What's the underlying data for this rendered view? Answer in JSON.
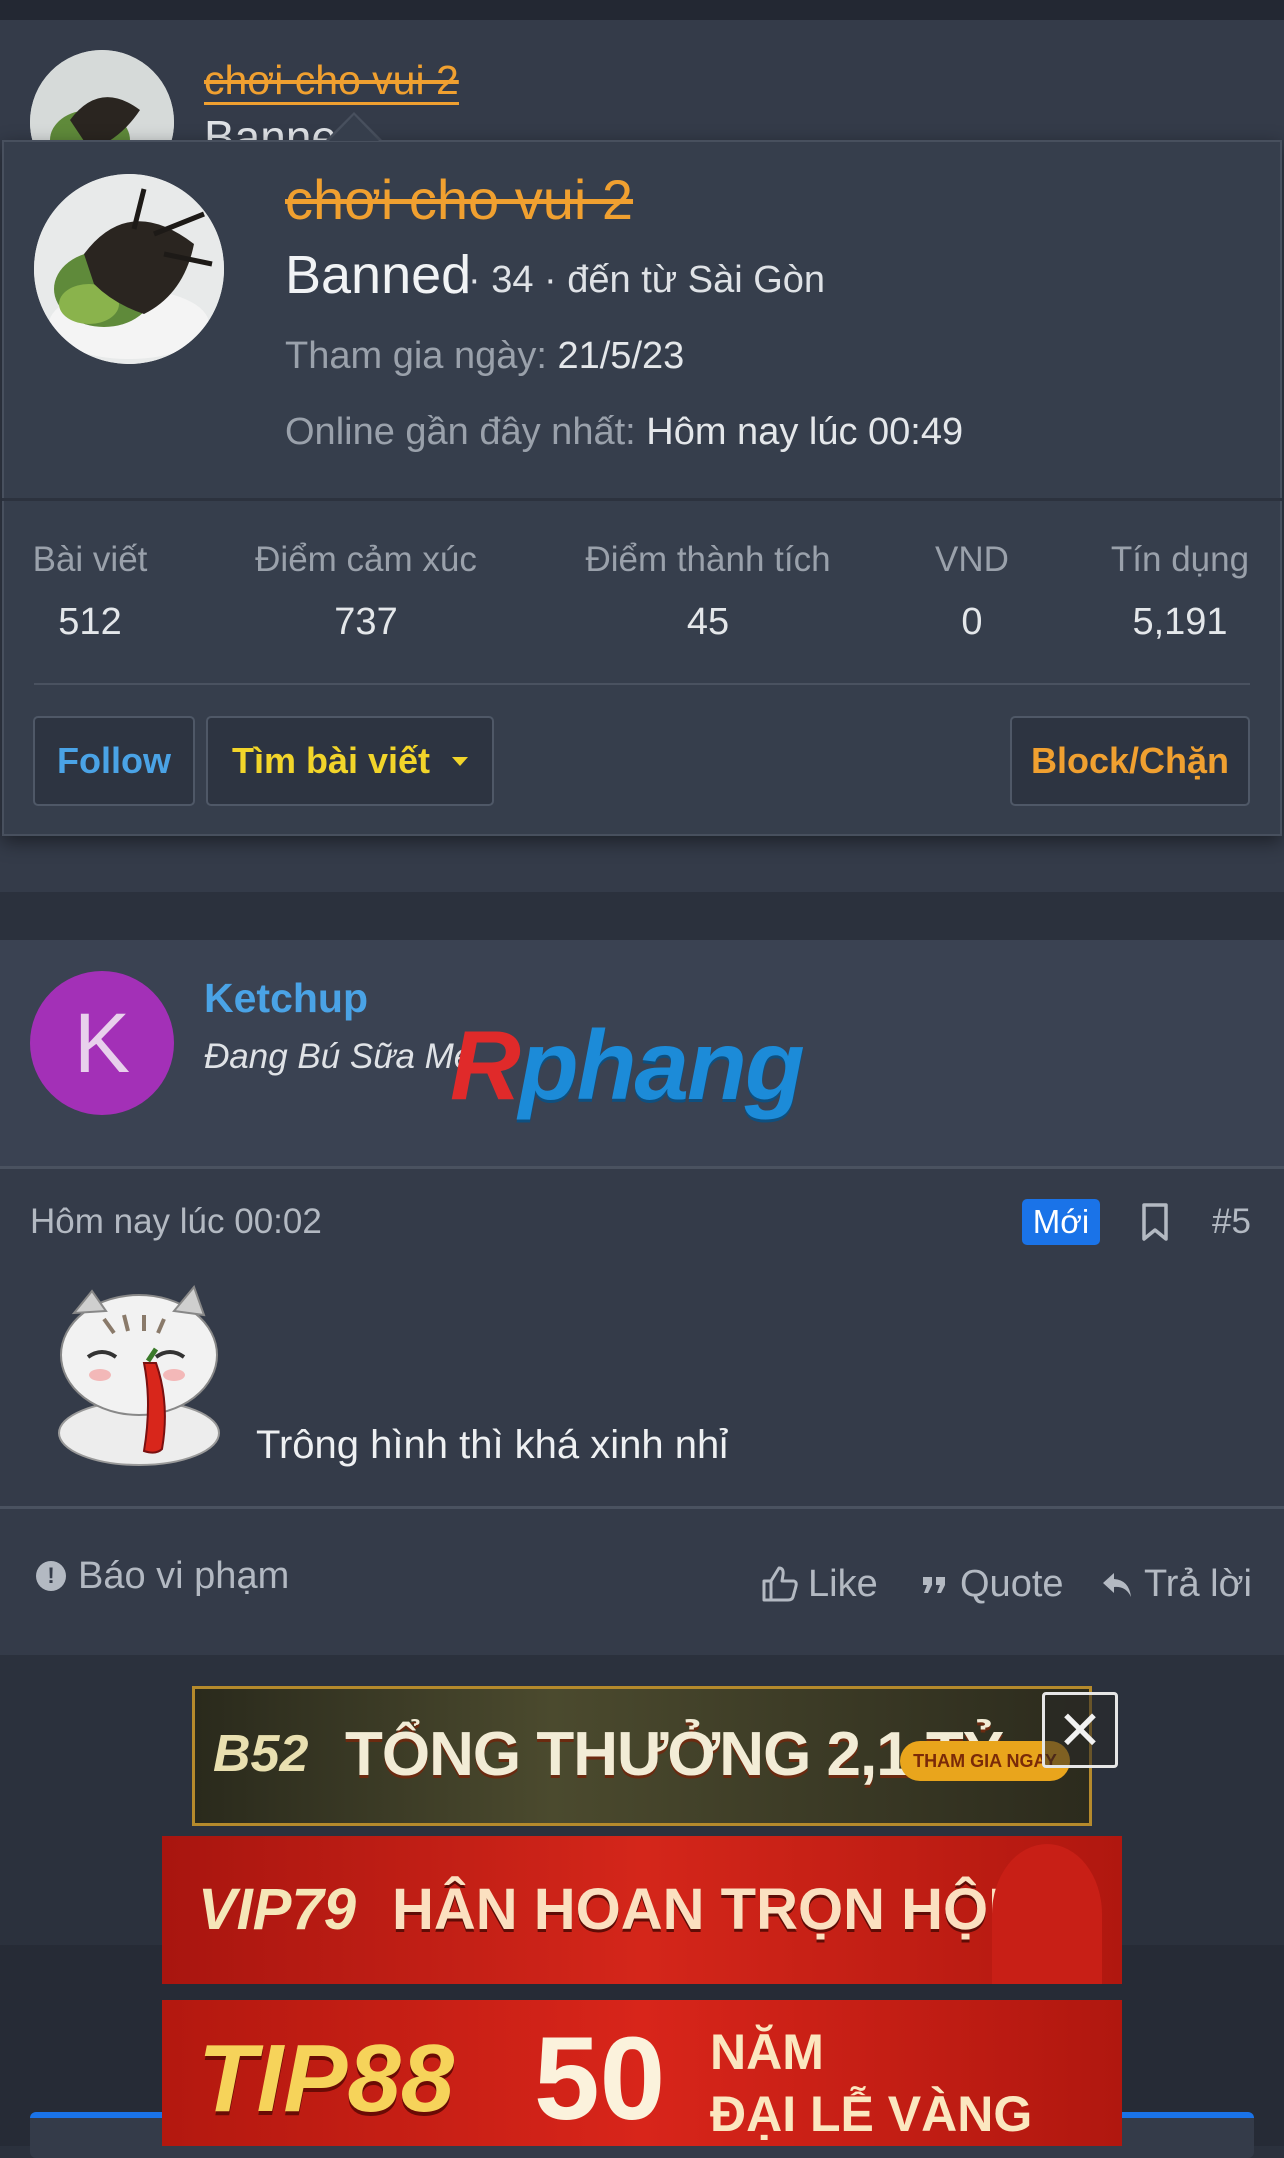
{
  "post1": {
    "username": "chơi cho vui 2",
    "user_title_partial": "Banned"
  },
  "profile_popup": {
    "username": "chơi cho vui 2",
    "user_title": "Banned",
    "meta": "· 34 · đến từ Sài Gòn",
    "joined_label": "Tham gia ngày:",
    "joined_value": "21/5/23",
    "last_seen_label": "Online gần đây nhất:",
    "last_seen_value": "Hôm nay lúc 00:49",
    "stats": [
      {
        "label": "Bài viết",
        "value": "512"
      },
      {
        "label": "Điểm cảm xúc",
        "value": "737"
      },
      {
        "label": "Điểm thành tích",
        "value": "45"
      },
      {
        "label": "VND",
        "value": "0"
      },
      {
        "label": "Tín dụng",
        "value": "5,191"
      }
    ],
    "follow_label": "Follow",
    "find_posts_label": "Tìm bài viết",
    "block_label": "Block/Chặn",
    "colors": {
      "banned_name": "#f0a030",
      "follow": "#4aa3e6",
      "find": "#f2d52a"
    }
  },
  "post2": {
    "avatar_letter": "K",
    "username": "Ketchup",
    "user_title": "Đang Bú Sữa Mẹ",
    "timestamp": "Hôm nay lúc 00:02",
    "new_badge": "Mới",
    "post_number": "#5",
    "body": "Trông hình thì khá xinh nhỉ",
    "report_label": "Báo vi phạm",
    "like_label": "Like",
    "quote_label": "Quote",
    "reply_label": "Trả lời",
    "colors": {
      "avatar_bg": "#a330b7",
      "username": "#4aa3e6",
      "new_badge": "#1a73e8"
    }
  },
  "watermark": {
    "part_a": "R",
    "part_b": "phang"
  },
  "ads": {
    "ad1_logo": "B52",
    "ad1_text": "TỔNG THƯỞNG 2,1 TỶ",
    "ad1_badge": "THAM GIA NGAY",
    "close_symbol": "✕",
    "ad2_logo": "VIP79",
    "ad2_text": "HÂN HOAN TRỌN HỘI",
    "ad3_logo": "TIP88",
    "ad3_number": "50",
    "ad3_line1": "NĂM",
    "ad3_line2": "ĐẠI LỄ VÀNG"
  },
  "icons": [
    "report-icon",
    "like-icon",
    "quote-icon",
    "reply-icon",
    "bookmark-icon",
    "caret-down-icon",
    "close-icon"
  ]
}
